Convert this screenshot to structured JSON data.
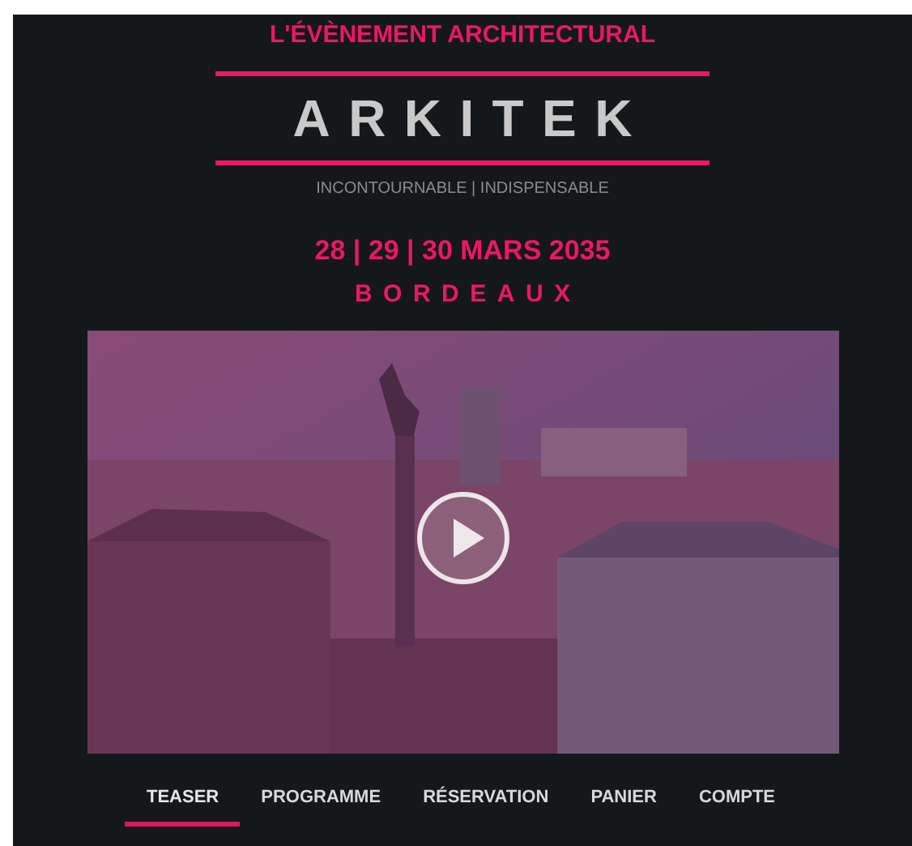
{
  "header": {
    "kicker": "L'ÉVÈNEMENT ARCHITECTURAL",
    "logo": "ARKITEK",
    "tagline": "INCONTOURNABLE | INDISPENSABLE",
    "dates": "28 | 29 | 30 MARS 2035",
    "city": "BORDEAUX"
  },
  "nav": [
    {
      "label": "TEASER",
      "selected": true
    },
    {
      "label": "PROGRAMME",
      "selected": false
    },
    {
      "label": "RÉSERVATION",
      "selected": false
    },
    {
      "label": "PANIER",
      "selected": false
    },
    {
      "label": "COMPTE",
      "selected": false
    }
  ]
}
